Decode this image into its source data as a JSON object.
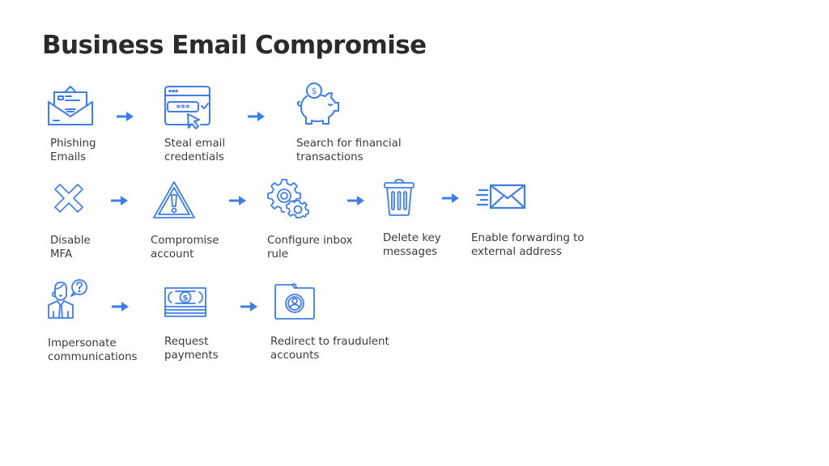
{
  "title": "Business Email Compromise",
  "accent_color": "#3f7ee8",
  "rows": [
    {
      "steps": [
        {
          "label": "Phishing\nEmails",
          "icon": "open-envelope-icon"
        },
        {
          "label": "Steal email\ncredentials",
          "icon": "password-browser-icon"
        },
        {
          "label": "Search for financial\ntransactions",
          "icon": "piggy-bank-icon"
        }
      ]
    },
    {
      "steps": [
        {
          "label": "Disable\nMFA",
          "icon": "x-mark-icon"
        },
        {
          "label": "Compromise\naccount",
          "icon": "warning-triangle-icon"
        },
        {
          "label": "Configure inbox\nrule",
          "icon": "gears-icon"
        },
        {
          "label": "Delete key\nmessages",
          "icon": "trash-can-icon"
        },
        {
          "label": "Enable forwarding to\nexternal address",
          "icon": "fast-mail-icon"
        }
      ]
    },
    {
      "steps": [
        {
          "label": "Impersonate\ncommunications",
          "icon": "person-question-icon"
        },
        {
          "label": "Request\npayments",
          "icon": "money-stack-icon"
        },
        {
          "label": "Redirect to fraudulent\naccounts",
          "icon": "account-folder-icon"
        }
      ]
    }
  ]
}
